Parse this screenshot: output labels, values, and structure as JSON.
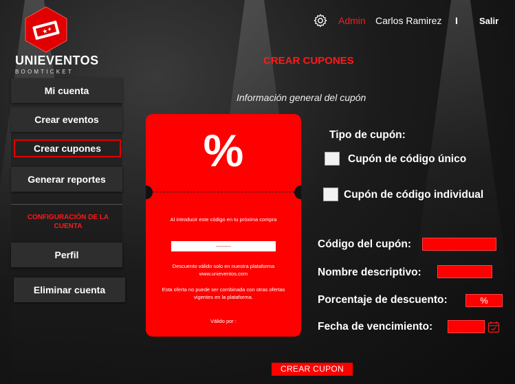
{
  "brand": {
    "name": "UNIEVENTOS",
    "tagline": "BOOMTICKET"
  },
  "header": {
    "role": "Admin",
    "user": "Carlos Ramirez",
    "separator": "I",
    "logout": "Salir"
  },
  "sidebar": {
    "items": [
      {
        "label": "Mi cuenta"
      },
      {
        "label": "Crear eventos"
      },
      {
        "label": "Crear cupones"
      },
      {
        "label": "Generar reportes"
      }
    ],
    "section_title": "CONFIGURACIÓN DE LA CUENTA",
    "account_items": [
      {
        "label": "Perfil"
      },
      {
        "label": "Eliminar cuenta"
      }
    ]
  },
  "main": {
    "title": "CREAR CUPONES",
    "subtitle": "Información general del cupón"
  },
  "coupon": {
    "symbol": "%",
    "intro": "Al introducir este código en tu próxima compra",
    "code_placeholder": "--------",
    "validity": "Descuento válido solo en nuestra plataforma www.unieventos.com",
    "restriction": "Esta oferta no puede ser combinada con otras ofertas vigentes en la plataforma.",
    "valid_until": "Válido por :"
  },
  "form": {
    "type_label": "Tipo de cupón:",
    "option_unique": "Cupón de código único",
    "option_individual": "Cupón de código individual",
    "code_label": "Código del cupón:",
    "name_label": "Nombre descriptivo:",
    "discount_label": "Porcentaje de descuento:",
    "discount_suffix": "%",
    "expiry_label": "Fecha de vencimiento:",
    "submit": "CREAR CUPON"
  },
  "colors": {
    "accent": "#ff0000",
    "background": "#1b1b1b"
  }
}
